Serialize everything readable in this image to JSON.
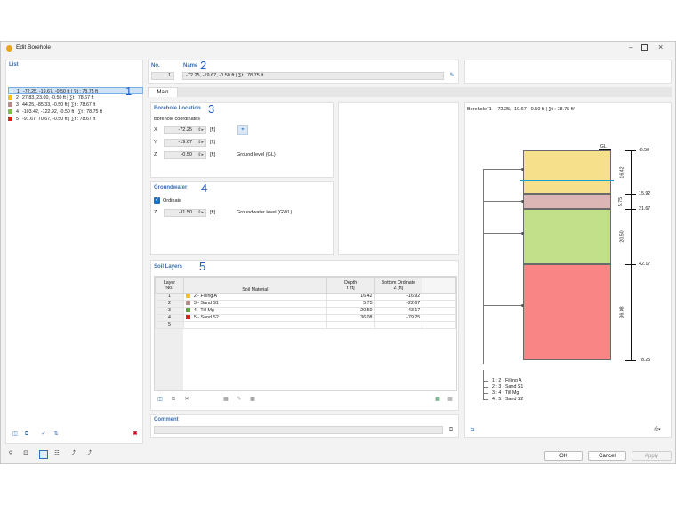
{
  "window": {
    "title": "Edit Borehole"
  },
  "list": {
    "title": "List",
    "items": [
      {
        "no": "1",
        "text": "-72.25, -19.67, -0.50 ft | ∑t : 78.75 ft",
        "color": "#d6ecf7"
      },
      {
        "no": "2",
        "text": "27.83, 23.00, -0.50 ft | ∑t : 78.67 ft",
        "color": "#f2c418"
      },
      {
        "no": "3",
        "text": "44.25, -85.33, -0.50 ft | ∑t : 78.67 ft",
        "color": "#b98a8a"
      },
      {
        "no": "4",
        "text": "-103.42, -122.92, -0.50 ft | ∑t : 78.75 ft",
        "color": "#7fbf3f"
      },
      {
        "no": "5",
        "text": "-91.67, 70.67, -0.50 ft | ∑t : 78.67 ft",
        "color": "#e0201e"
      }
    ]
  },
  "annotations": {
    "n1": "1",
    "n2": "2",
    "n3": "3",
    "n4": "4",
    "n5": "5"
  },
  "header": {
    "no_label": "No.",
    "no_value": "1",
    "name_label": "Name",
    "name_value": "-72.25, -19.67, -0.50 ft | ∑t : 78.75 ft"
  },
  "tabs": [
    {
      "label": "Main"
    }
  ],
  "location": {
    "title": "Borehole Location",
    "coords_label": "Borehole coordinates",
    "x_label": "X",
    "x_value": "-72.25",
    "x_unit": "[ft]",
    "y_label": "Y",
    "y_value": "-19.67",
    "y_unit": "[ft]",
    "z_label": "Z",
    "z_value": "-0.50",
    "z_unit": "[ft]",
    "z_note": "Ground level (GL)"
  },
  "groundwater": {
    "title": "Groundwater",
    "ordinate_label": "Ordinate",
    "ordinate_checked": true,
    "z_label": "Z",
    "z_value": "-11.50",
    "z_unit": "[ft]",
    "z_note": "Groundwater level (GWL)"
  },
  "soil_layers": {
    "title": "Soil Layers",
    "columns": [
      "Layer No.",
      "Soil Material",
      "Depth t [ft]",
      "Bottom Ordinate Z [ft]"
    ],
    "col_layer_1": "Layer",
    "col_layer_2": "No.",
    "col_material": "Soil Material",
    "col_depth_1": "Depth",
    "col_depth_2": "t [ft]",
    "col_bottom_1": "Bottom Ordinate",
    "col_bottom_2": "Z [ft]",
    "rows": [
      {
        "no": "1",
        "material": "2 - Filling A",
        "depth": "16.42",
        "bottom": "-16.92",
        "color": "#f2c418"
      },
      {
        "no": "2",
        "material": "3 - Sand S1",
        "depth": "5.75",
        "bottom": "-22.67",
        "color": "#b98a8a"
      },
      {
        "no": "3",
        "material": "4 - Till Mg",
        "depth": "20.50",
        "bottom": "-43.17",
        "color": "#5fa836"
      },
      {
        "no": "4",
        "material": "5 - Sand S2",
        "depth": "36.08",
        "bottom": "-79.25",
        "color": "#e0201e"
      },
      {
        "no": "5",
        "material": "",
        "depth": "",
        "bottom": "",
        "color": ""
      }
    ]
  },
  "comment": {
    "title": "Comment",
    "value": ""
  },
  "preview": {
    "title": "Borehole '1 - -72.25, -19.67, -0.50 ft | ∑t : 78.75 ft'",
    "gl_label": "GL",
    "levels": [
      "-0.50",
      "15.92",
      "21.67",
      "42.17",
      "78.25"
    ],
    "thickness": [
      "16.42",
      "5.75",
      "20.50",
      "36.08"
    ],
    "legend": [
      "1 : 2 - Filling A",
      "2 : 3 - Sand S1",
      "3 : 4 - Till Mg",
      "4 : 5 - Sand S2"
    ],
    "layer_colors": [
      "#f7e08c",
      "#dcb5b5",
      "#c2df8a",
      "#f98585"
    ],
    "water_color": "#1aa0c8"
  },
  "buttons": {
    "ok": "OK",
    "cancel": "Cancel",
    "apply": "Apply"
  }
}
